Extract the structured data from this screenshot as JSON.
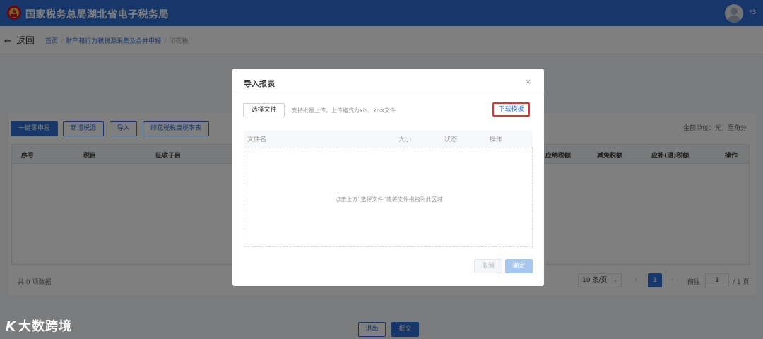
{
  "header": {
    "title": "国家税务总局湖北省电子税务局",
    "user": "*3",
    "logo_icon": "tax-emblem-icon",
    "avatar_icon": "user-avatar-icon",
    "brand_color": "#2f6fd6"
  },
  "nav": {
    "back_label": "返回",
    "breadcrumbs": [
      "首页",
      "财产和行为税税源采集及合并申报",
      "印花税"
    ]
  },
  "toolbar": {
    "buttons": [
      "一键零申报",
      "新增税源",
      "导入",
      "印花税税目税率表"
    ],
    "unit_label": "金额单位：元，至角分"
  },
  "table": {
    "columns": [
      "序号",
      "税目",
      "征收子目",
      "应纳税额",
      "减免税额",
      "应补(退)税额",
      "操作"
    ]
  },
  "pagination": {
    "total": "共 0 项数据",
    "page_size": "10 条/页",
    "current_page": "1",
    "goto_label": "前往",
    "goto_value": "1",
    "total_pages": "/ 1 页"
  },
  "footer": {
    "back_label": "退出",
    "submit_label": "提交"
  },
  "watermark": {
    "mark": "K",
    "text": "大数跨境"
  },
  "modal": {
    "title": "导入报表",
    "close_symbol": "×",
    "choose_file_label": "选择文件",
    "hint": "支持批量上传，上传格式为xls、xlsx文件",
    "download_label": "下载模板",
    "columns": [
      "文件名",
      "大小",
      "状态",
      "操作"
    ],
    "empty_text": "点击上方“选择文件”或将文件拖拽到此区域",
    "cancel_label": "取消",
    "ok_label": "确定",
    "highlight_color": "#e0352b"
  }
}
